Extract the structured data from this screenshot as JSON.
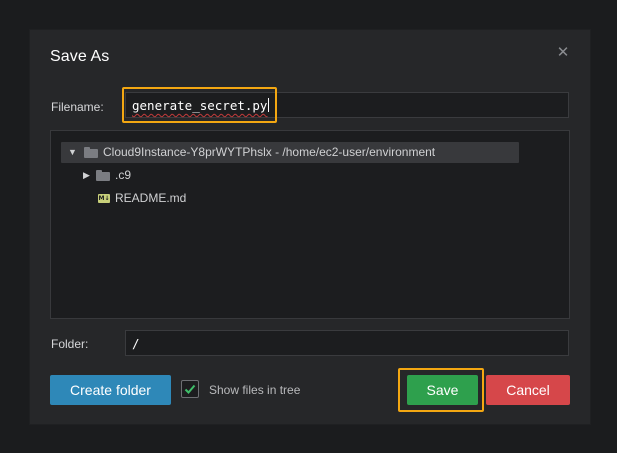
{
  "dialog": {
    "title": "Save As",
    "close_icon": "close-icon"
  },
  "filename": {
    "label": "Filename:",
    "value": "generate_secret.py"
  },
  "tree": {
    "root": {
      "label": "Cloud9Instance-Y8prWYTPhslx - /home/ec2-user/environment",
      "icon": "folder-icon",
      "expanded": true
    },
    "items": [
      {
        "label": ".c9",
        "icon": "folder-icon",
        "expanded": false
      },
      {
        "label": "README.md",
        "icon": "markdown-file-icon"
      }
    ]
  },
  "folder": {
    "label": "Folder:",
    "value": "/"
  },
  "footer": {
    "create_folder_label": "Create folder",
    "show_files_label": "Show files in tree",
    "show_files_checked": true,
    "save_label": "Save",
    "cancel_label": "Cancel"
  },
  "colors": {
    "highlight": "#f3a712",
    "save": "#2ea04d",
    "cancel": "#d6474a",
    "create_folder": "#2e88b8"
  }
}
